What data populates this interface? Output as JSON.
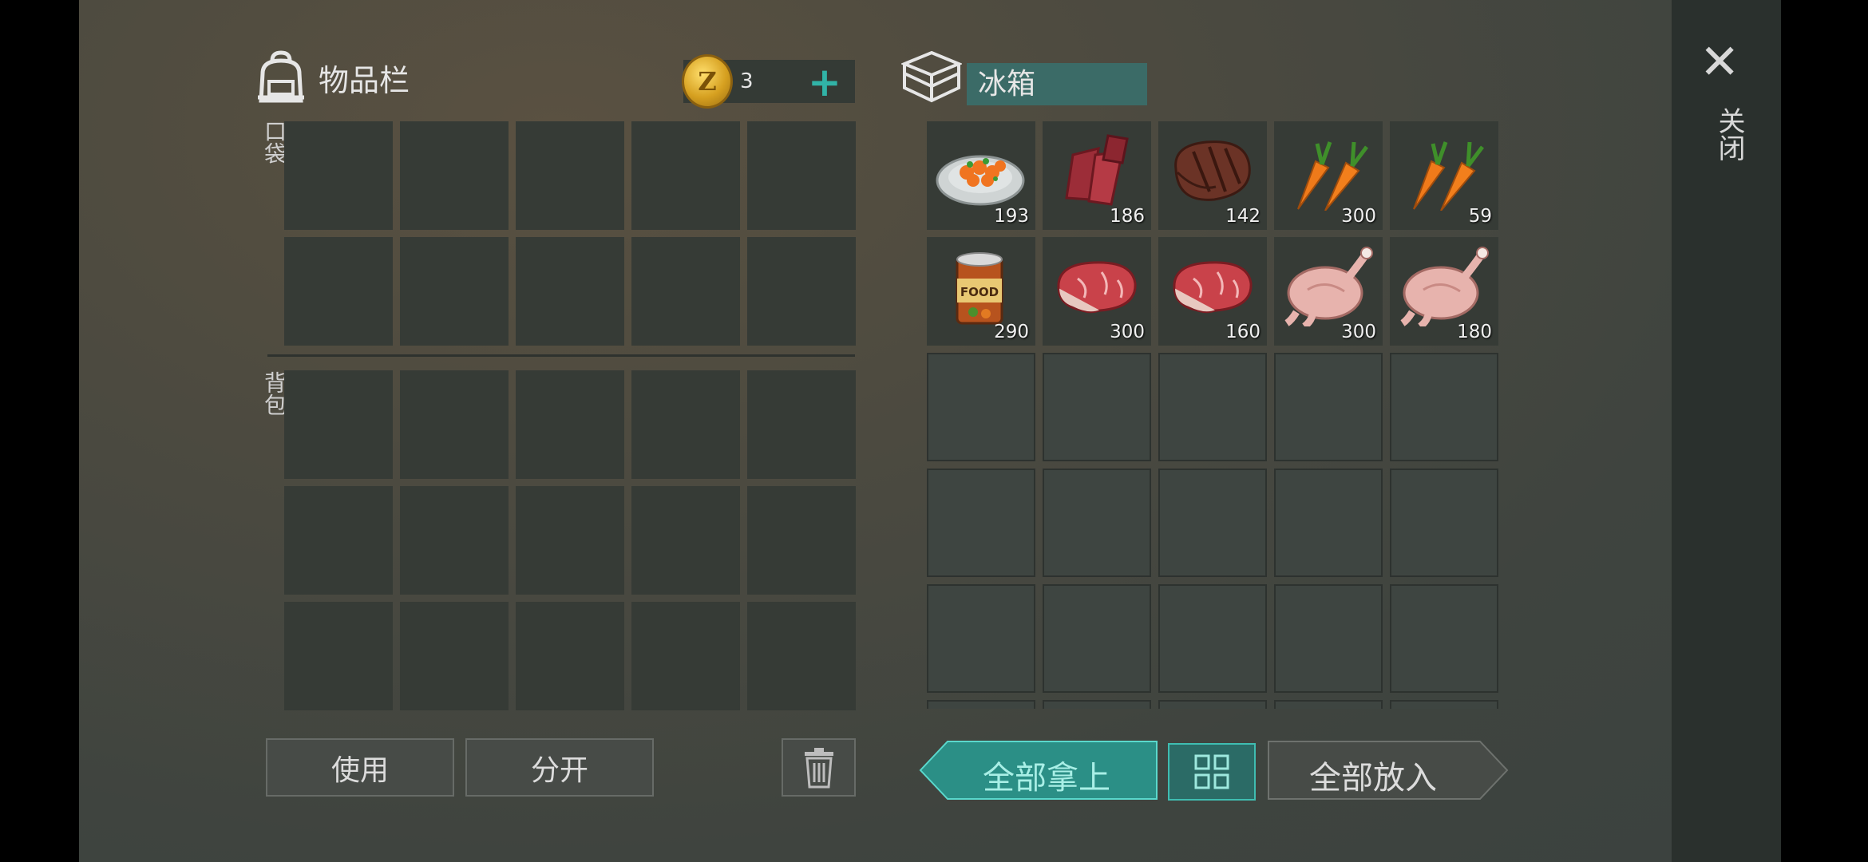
{
  "inventory": {
    "title": "物品栏",
    "coins": "3",
    "coin_symbol": "Z",
    "plus": "+",
    "pocket_label": "口袋",
    "backpack_label": "背包",
    "pocket_slots": 10,
    "backpack_slots": 15
  },
  "container": {
    "name": "冰箱",
    "items": [
      {
        "name": "carrot-dish-icon",
        "qty": "193"
      },
      {
        "name": "jerky-icon",
        "qty": "186"
      },
      {
        "name": "cooked-steak-icon",
        "qty": "142"
      },
      {
        "name": "carrot-icon",
        "qty": "300"
      },
      {
        "name": "carrot-icon",
        "qty": "59"
      },
      {
        "name": "canned-food-icon",
        "qty": "290",
        "can_label": "FOOD"
      },
      {
        "name": "raw-meat-icon",
        "qty": "300"
      },
      {
        "name": "raw-meat-icon",
        "qty": "160"
      },
      {
        "name": "raw-chicken-icon",
        "qty": "300"
      },
      {
        "name": "raw-chicken-icon",
        "qty": "180"
      }
    ]
  },
  "actions": {
    "use": "使用",
    "split": "分开",
    "take_all": "全部拿上",
    "put_all": "全部放入",
    "close": "关闭",
    "close_symbol": "✕"
  },
  "colors": {
    "accent": "#31b3a7",
    "take_button": "#2b8f86",
    "container_name_bg": "#3b6b67"
  }
}
